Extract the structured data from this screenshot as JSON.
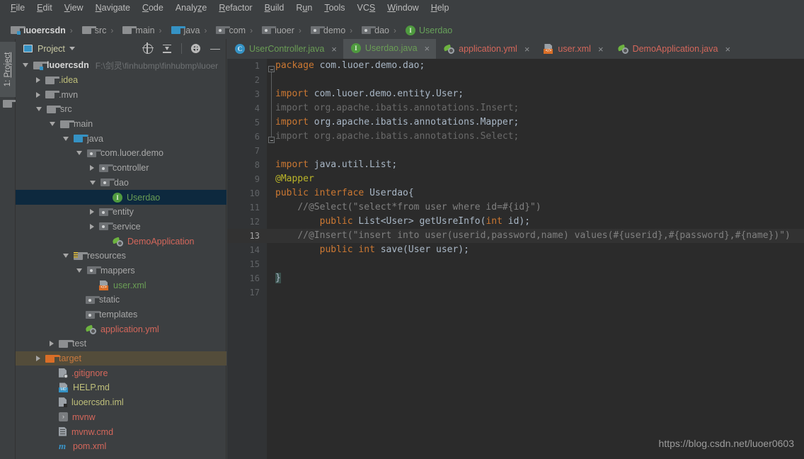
{
  "menu": {
    "items": [
      {
        "label": "File",
        "accel": "F"
      },
      {
        "label": "Edit",
        "accel": "E"
      },
      {
        "label": "View",
        "accel": "V"
      },
      {
        "label": "Navigate",
        "accel": "N"
      },
      {
        "label": "Code",
        "accel": "C"
      },
      {
        "label": "Analyze",
        "accel": "z"
      },
      {
        "label": "Refactor",
        "accel": "R"
      },
      {
        "label": "Build",
        "accel": "B"
      },
      {
        "label": "Run",
        "accel": "u"
      },
      {
        "label": "Tools",
        "accel": "T"
      },
      {
        "label": "VCS",
        "accel": "S"
      },
      {
        "label": "Window",
        "accel": "W"
      },
      {
        "label": "Help",
        "accel": "H"
      }
    ]
  },
  "breadcrumb": {
    "separator": "›",
    "items": [
      {
        "label": "luoercsdn",
        "icon": "project-folder-icon",
        "style": "bold"
      },
      {
        "label": "src",
        "icon": "folder-icon",
        "style": "plain"
      },
      {
        "label": "main",
        "icon": "folder-icon",
        "style": "plain"
      },
      {
        "label": "java",
        "icon": "source-folder-icon",
        "style": "plain"
      },
      {
        "label": "com",
        "icon": "package-icon",
        "style": "plain"
      },
      {
        "label": "luoer",
        "icon": "package-icon",
        "style": "plain"
      },
      {
        "label": "demo",
        "icon": "package-icon",
        "style": "plain"
      },
      {
        "label": "dao",
        "icon": "package-icon",
        "style": "plain"
      },
      {
        "label": "Userdao",
        "icon": "interface-icon",
        "style": "green"
      }
    ]
  },
  "toolstrip": {
    "project_button": {
      "number": "1: ",
      "label": "Project"
    }
  },
  "panel": {
    "title": "Project",
    "tools": [
      "locate-icon",
      "collapse-all-icon",
      "settings-icon",
      "hide-icon"
    ],
    "tree": [
      {
        "label": "luoercsdn",
        "path": "F:\\剑灵\\finhubmp\\finhubmp\\luoer",
        "indent": 0,
        "arrow": "down",
        "icon": "project-folder-icon",
        "color": "white"
      },
      {
        "label": ".idea",
        "indent": 1,
        "arrow": "right",
        "icon": "folder-icon",
        "color": "yellow"
      },
      {
        "label": ".mvn",
        "indent": 1,
        "arrow": "right",
        "icon": "folder-icon",
        "color": "plain"
      },
      {
        "label": "src",
        "indent": 1,
        "arrow": "down",
        "icon": "folder-icon",
        "color": "plain"
      },
      {
        "label": "main",
        "indent": 2,
        "arrow": "down",
        "icon": "folder-icon",
        "color": "plain"
      },
      {
        "label": "java",
        "indent": 3,
        "arrow": "down",
        "icon": "source-folder-icon",
        "color": "plain"
      },
      {
        "label": "com.luoer.demo",
        "indent": 4,
        "arrow": "down",
        "icon": "package-icon",
        "color": "plain"
      },
      {
        "label": "controller",
        "indent": 5,
        "arrow": "right",
        "icon": "package-icon",
        "color": "plain"
      },
      {
        "label": "dao",
        "indent": 5,
        "arrow": "down",
        "icon": "package-icon",
        "color": "plain"
      },
      {
        "label": "Userdao",
        "indent": 6,
        "arrow": "none",
        "icon": "interface-icon",
        "color": "green",
        "state": "selected"
      },
      {
        "label": "entity",
        "indent": 5,
        "arrow": "right",
        "icon": "package-icon",
        "color": "plain"
      },
      {
        "label": "service",
        "indent": 5,
        "arrow": "right",
        "icon": "package-icon",
        "color": "plain"
      },
      {
        "label": "DemoApplication",
        "indent": 6,
        "arrow": "none",
        "icon": "spring-class-icon",
        "color": "salmon"
      },
      {
        "label": "resources",
        "indent": 3,
        "arrow": "down",
        "icon": "resources-folder-icon",
        "color": "plain"
      },
      {
        "label": "mappers",
        "indent": 4,
        "arrow": "down",
        "icon": "package-icon",
        "color": "plain"
      },
      {
        "label": "user.xml",
        "indent": 5,
        "arrow": "none",
        "icon": "xml-file-icon",
        "color": "green"
      },
      {
        "label": "static",
        "indent": 4,
        "arrow": "none",
        "icon": "package-icon",
        "color": "plain"
      },
      {
        "label": "templates",
        "indent": 4,
        "arrow": "none",
        "icon": "package-icon",
        "color": "plain"
      },
      {
        "label": "application.yml",
        "indent": 4,
        "arrow": "none",
        "icon": "spring-yml-icon",
        "color": "salmon"
      },
      {
        "label": "test",
        "indent": 2,
        "arrow": "right",
        "icon": "folder-icon",
        "color": "plain"
      },
      {
        "label": "target",
        "indent": 1,
        "arrow": "right",
        "icon": "excluded-folder-icon",
        "color": "orange",
        "state": "excluded"
      },
      {
        "label": ".gitignore",
        "indent": 2,
        "arrow": "none",
        "icon": "gitignore-file-icon",
        "color": "salmon"
      },
      {
        "label": "HELP.md",
        "indent": 2,
        "arrow": "none",
        "icon": "markdown-file-icon",
        "color": "yellow"
      },
      {
        "label": "luoercsdn.iml",
        "indent": 2,
        "arrow": "none",
        "icon": "iml-file-icon",
        "color": "yellow"
      },
      {
        "label": "mvnw",
        "indent": 2,
        "arrow": "none",
        "icon": "shell-file-icon",
        "color": "salmon"
      },
      {
        "label": "mvnw.cmd",
        "indent": 2,
        "arrow": "none",
        "icon": "cmd-file-icon",
        "color": "salmon"
      },
      {
        "label": "pom.xml",
        "indent": 2,
        "arrow": "none",
        "icon": "maven-file-icon",
        "color": "salmon"
      }
    ]
  },
  "editor": {
    "tabs": [
      {
        "label": "UserController.java",
        "icon": "java-class-icon",
        "color": "green",
        "active": false
      },
      {
        "label": "Userdao.java",
        "icon": "java-interface-icon",
        "color": "green",
        "active": true
      },
      {
        "label": "application.yml",
        "icon": "spring-yml-icon",
        "color": "red",
        "active": false
      },
      {
        "label": "user.xml",
        "icon": "xml-file-icon",
        "color": "red",
        "active": false
      },
      {
        "label": "DemoApplication.java",
        "icon": "spring-class-icon",
        "color": "red",
        "active": false
      }
    ],
    "close_glyph": "×",
    "caret_line": 13,
    "code_lines": [
      {
        "n": 1,
        "text": "package com.luoer.demo.dao;"
      },
      {
        "n": 2,
        "text": ""
      },
      {
        "n": 3,
        "text": "import com.luoer.demo.entity.User;",
        "fold": true
      },
      {
        "n": 4,
        "text": "import org.apache.ibatis.annotations.Insert;",
        "dim": true
      },
      {
        "n": 5,
        "text": "import org.apache.ibatis.annotations.Mapper;"
      },
      {
        "n": 6,
        "text": "import org.apache.ibatis.annotations.Select;",
        "dim": true
      },
      {
        "n": 7,
        "text": ""
      },
      {
        "n": 8,
        "text": "import java.util.List;",
        "fold": true
      },
      {
        "n": 9,
        "text": "@Mapper"
      },
      {
        "n": 10,
        "text": "public interface Userdao{"
      },
      {
        "n": 11,
        "text": "    //@Select(\"select*from user where id=#{id}\")"
      },
      {
        "n": 12,
        "text": "    public List<User> getUsreInfo(int id);"
      },
      {
        "n": 13,
        "text": "    //@Insert(\"insert into user(userid,password,name) values(#{userid},#{password},#{name})\")"
      },
      {
        "n": 14,
        "text": "    public int save(User user);"
      },
      {
        "n": 15,
        "text": ""
      },
      {
        "n": 16,
        "text": "}"
      },
      {
        "n": 17,
        "text": ""
      }
    ]
  },
  "watermark": "https://blog.csdn.net/luoer0603",
  "colors": {
    "window_bg": "#3c3f41",
    "editor_bg": "#2b2b2b",
    "gutter_bg": "#313335",
    "selection_bg": "#0d293e",
    "excluded_bg": "#534c3a",
    "caret_line_bg": "#323232",
    "keyword": "#cc7832",
    "comment": "#808080",
    "annotation": "#bbb529",
    "text": "#a9b7c6",
    "green_file": "#6a9d55",
    "salmon_file": "#d4675b"
  }
}
